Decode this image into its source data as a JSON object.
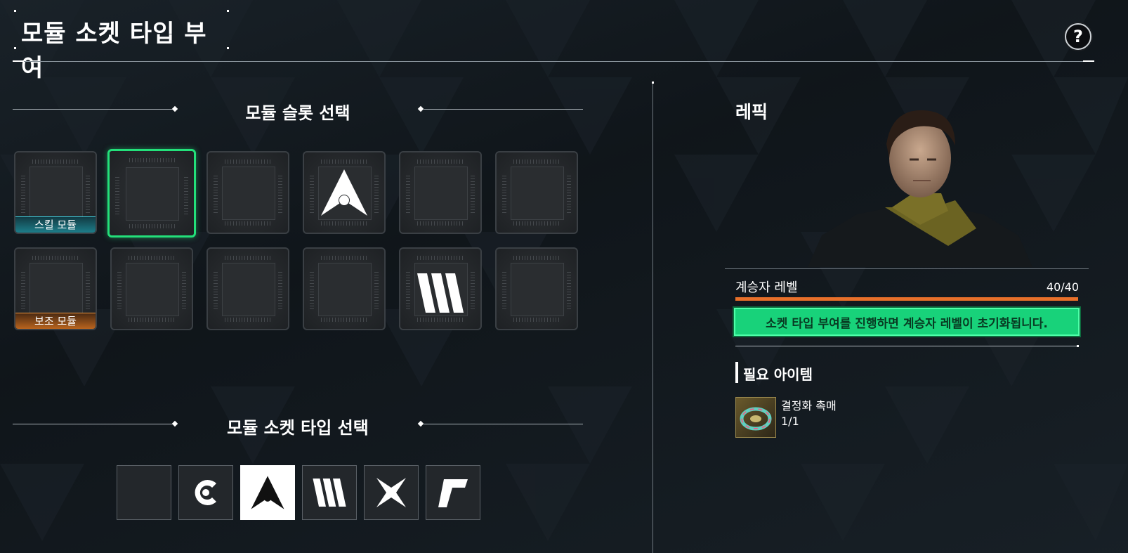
{
  "header": {
    "title": "모듈 소켓 타입 부여",
    "help_label": "?"
  },
  "slots_section": {
    "title": "모듈 슬롯 선택"
  },
  "slots": {
    "row1": [
      {
        "tag": "스킬 모듈",
        "symbol": "",
        "selected": false
      },
      {
        "tag": "",
        "symbol": "",
        "selected": true
      },
      {
        "tag": "",
        "symbol": "",
        "selected": false
      },
      {
        "tag": "",
        "symbol": "arrow-a-icon",
        "selected": false
      },
      {
        "tag": "",
        "symbol": "",
        "selected": false
      },
      {
        "tag": "",
        "symbol": "",
        "selected": false
      }
    ],
    "row2": [
      {
        "tag": "보조 모듈",
        "symbol": "",
        "selected": false
      },
      {
        "tag": "",
        "symbol": "",
        "selected": false
      },
      {
        "tag": "",
        "symbol": "",
        "selected": false
      },
      {
        "tag": "",
        "symbol": "",
        "selected": false
      },
      {
        "tag": "",
        "symbol": "triple-bar-icon",
        "selected": false
      },
      {
        "tag": "",
        "symbol": "",
        "selected": false
      }
    ]
  },
  "socket_section": {
    "title": "모듈 소켓 타입 선택"
  },
  "socket_types": [
    {
      "icon": "empty-socket-icon",
      "selected": false
    },
    {
      "icon": "c-ring-icon",
      "selected": false
    },
    {
      "icon": "arrow-a-icon",
      "selected": true
    },
    {
      "icon": "triple-bar-icon",
      "selected": false
    },
    {
      "icon": "four-point-star-icon",
      "selected": false
    },
    {
      "icon": "r-shape-icon",
      "selected": false
    }
  ],
  "character": {
    "name": "레픽",
    "level_label": "계승자 레벨",
    "level_value": "40/40",
    "level_fraction": 1.0,
    "warning": "소켓 타입 부여를 진행하면 계승자 레벨이 초기화됩니다."
  },
  "required": {
    "title": "필요 아이템",
    "item_name": "결정화 촉매",
    "item_count": "1/1"
  },
  "colors": {
    "accent_green": "#18d27a",
    "level_orange": "#e8702a",
    "skill_tag": "#1d7e8a",
    "sub_tag": "#b8641e"
  }
}
